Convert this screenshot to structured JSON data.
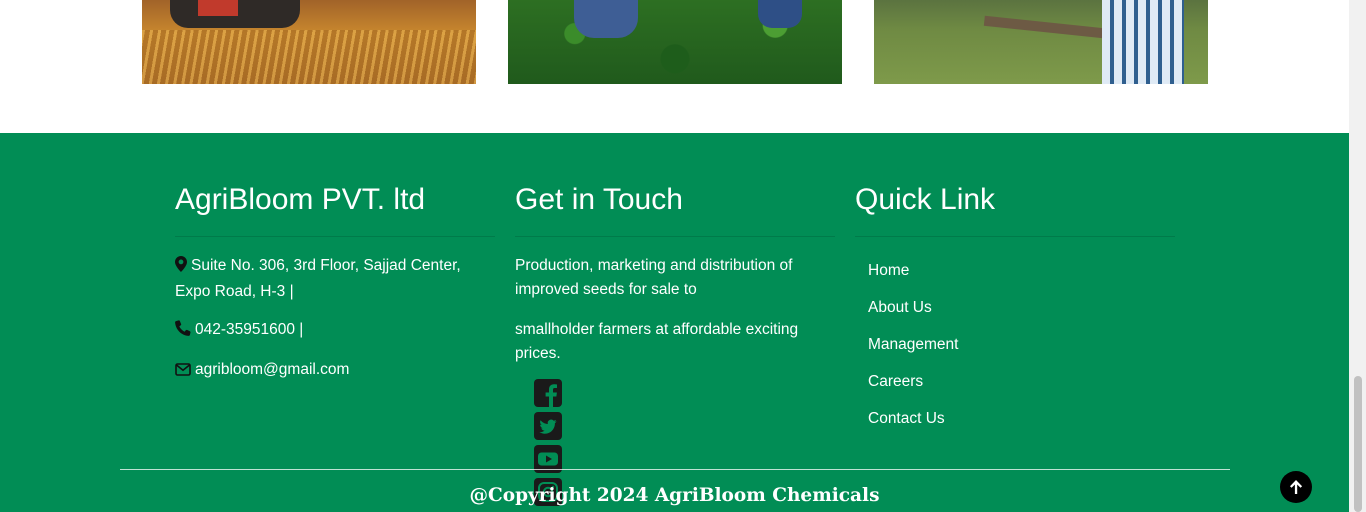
{
  "images": [
    {
      "icon": "wheat-field-tractor-photo"
    },
    {
      "icon": "crop-field-workers-photo"
    },
    {
      "icon": "farmer-on-grass-photo"
    }
  ],
  "company": {
    "title": "AgriBloom PVT. ltd",
    "address": "Suite No. 306, 3rd Floor, Sajjad Center, Expo Road, H-3 |",
    "phone": "042-35951600 |",
    "email": "agribloom@gmail.com"
  },
  "contact": {
    "title": "Get in Touch",
    "line1": "Production, marketing and distribution of improved seeds for sale to",
    "line2": "smallholder farmers at affordable exciting prices.",
    "social": [
      "facebook-icon",
      "twitter-icon",
      "youtube-icon",
      "instagram-icon"
    ]
  },
  "quick_links": {
    "title": "Quick Link",
    "items": [
      "Home",
      "About Us",
      "Management",
      "Careers",
      "Contact Us"
    ]
  },
  "copyright": "@Copyright 2024 AgriBloom Chemicals",
  "colors": {
    "footer_bg": "#018d55",
    "text": "#ffffff",
    "icon_dark": "#1a1a1a"
  }
}
